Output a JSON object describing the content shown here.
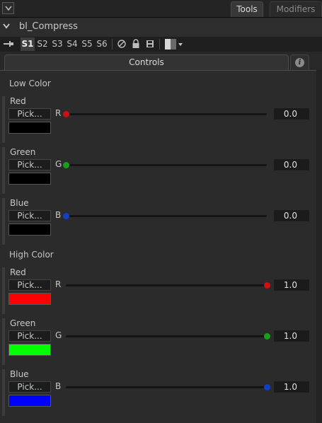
{
  "tabs": {
    "tools": "Tools",
    "modifiers": "Modifiers"
  },
  "tool": {
    "name": "bl_Compress"
  },
  "versions": [
    "S1",
    "S2",
    "S3",
    "S4",
    "S5",
    "S6"
  ],
  "controls_tab": "Controls",
  "low": {
    "label": "Low Color",
    "channels": [
      {
        "name": "Red",
        "letter": "R",
        "pick": "Pick...",
        "value": "0.0",
        "level": 0.0,
        "knob_color": "#d01010",
        "swatch": "#000000"
      },
      {
        "name": "Green",
        "letter": "G",
        "pick": "Pick...",
        "value": "0.0",
        "level": 0.0,
        "knob_color": "#18a018",
        "swatch": "#000000"
      },
      {
        "name": "Blue",
        "letter": "B",
        "pick": "Pick...",
        "value": "0.0",
        "level": 0.0,
        "knob_color": "#1040c8",
        "swatch": "#000000"
      }
    ]
  },
  "high": {
    "label": "High Color",
    "channels": [
      {
        "name": "Red",
        "letter": "R",
        "pick": "Pick...",
        "value": "1.0",
        "level": 1.0,
        "knob_color": "#d01010",
        "swatch": "#ff0000"
      },
      {
        "name": "Green",
        "letter": "G",
        "pick": "Pick...",
        "value": "1.0",
        "level": 1.0,
        "knob_color": "#18a018",
        "swatch": "#00ff00"
      },
      {
        "name": "Blue",
        "letter": "B",
        "pick": "Pick...",
        "value": "1.0",
        "level": 1.0,
        "knob_color": "#1040c8",
        "swatch": "#0000ff"
      }
    ]
  },
  "icons": [
    "collapse-icon",
    "chevron-down-icon",
    "pin-icon",
    "disable-icon",
    "lock-icon",
    "save-icon",
    "color-swatch-icon",
    "info-icon"
  ]
}
